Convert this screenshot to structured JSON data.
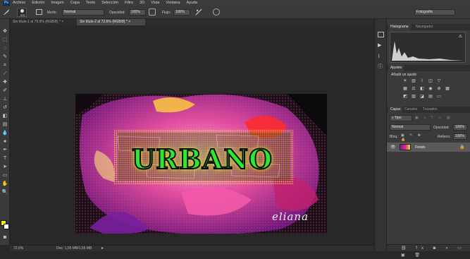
{
  "app": {
    "logo": "Ps"
  },
  "menu": [
    "Archivo",
    "Edición",
    "Imagen",
    "Capa",
    "Texto",
    "Selección",
    "Filtro",
    "3D",
    "Vista",
    "Ventana",
    "Ayuda"
  ],
  "options": {
    "brush_size": "370",
    "mode_label": "Modo:",
    "mode_value": "Normal",
    "opacity_label": "Opacidad:",
    "opacity_value": "100%",
    "flow_label": "Flujo:",
    "flow_value": "100%",
    "workspace": "Fotografía"
  },
  "tabs": [
    {
      "label": "Sin título-1 al 79,9% (RGB/8) *",
      "close": "×"
    },
    {
      "label": "Sin título-2 al 72,6% (RGB/8) *",
      "close": "×"
    }
  ],
  "artwork": {
    "title_text": "URBANO",
    "signature": "eliana",
    "colors": {
      "title_fill": "#2ee82e",
      "title_stroke": "#0a0a0a",
      "glow": "#d8e62a",
      "magenta": "#e0208c",
      "violet": "#7a1f9e"
    }
  },
  "status": {
    "zoom": "72,6%",
    "doc": "Doc: 1,55 MB/1,55 MB"
  },
  "panels": {
    "histogram_tabs": [
      "Histograma",
      "Navegador"
    ],
    "ajustes_tabs": [
      "Ajustes"
    ],
    "ajustes_title": "Añadir un ajuste",
    "layers_tabs": [
      "Capas",
      "Canales",
      "Trazados"
    ],
    "layers_kind": "Tipo",
    "layers_blend": "Normal",
    "opacity_label": "Opacidad:",
    "opacity_value": "100%",
    "lock_label": "Bloq.:",
    "fill_label": "Relleno:",
    "fill_value": "100%",
    "layer_name": "Fondo"
  }
}
